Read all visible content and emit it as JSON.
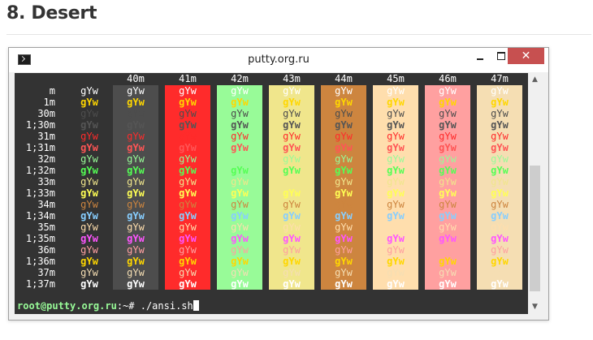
{
  "page": {
    "heading": "8. Desert"
  },
  "window": {
    "title": "putty.org.ru",
    "icon": "terminal-icon",
    "controls": {
      "minimize": "minimize-icon",
      "maximize": "maximize-icon",
      "close": "✕"
    }
  },
  "terminal": {
    "background": "#333333",
    "sample_text": "gYw",
    "backgrounds": [
      {
        "code": "",
        "color": null
      },
      {
        "code": "40m",
        "color": "#4d4d4d"
      },
      {
        "code": "41m",
        "color": "#ff2b2b"
      },
      {
        "code": "42m",
        "color": "#98fb98"
      },
      {
        "code": "43m",
        "color": "#f0e68c"
      },
      {
        "code": "44m",
        "color": "#cd853f"
      },
      {
        "code": "45m",
        "color": "#ffdead"
      },
      {
        "code": "46m",
        "color": "#ffa0a0"
      },
      {
        "code": "47m",
        "color": "#f5deb3"
      }
    ],
    "rows": [
      {
        "label": "m",
        "color": "#ffffff",
        "bold": false
      },
      {
        "label": "1m",
        "color": "#ffd700",
        "bold": true
      },
      {
        "label": "30m",
        "color": "#4d4d4d",
        "bold": false
      },
      {
        "label": "1;30m",
        "color": "#555555",
        "bold": true
      },
      {
        "label": "31m",
        "color": "#ff2b2b",
        "bold": false
      },
      {
        "label": "1;31m",
        "color": "#ff5555",
        "bold": true
      },
      {
        "label": "32m",
        "color": "#98fb98",
        "bold": false
      },
      {
        "label": "1;32m",
        "color": "#55ff55",
        "bold": true
      },
      {
        "label": "33m",
        "color": "#f0e68c",
        "bold": false
      },
      {
        "label": "1;33m",
        "color": "#ffff55",
        "bold": true
      },
      {
        "label": "34m",
        "color": "#cd853f",
        "bold": false
      },
      {
        "label": "1;34m",
        "color": "#87ceff",
        "bold": true
      },
      {
        "label": "35m",
        "color": "#ffdead",
        "bold": false
      },
      {
        "label": "1;35m",
        "color": "#ff55ff",
        "bold": true
      },
      {
        "label": "36m",
        "color": "#ffa0a0",
        "bold": false
      },
      {
        "label": "1;36m",
        "color": "#ffd700",
        "bold": true
      },
      {
        "label": "37m",
        "color": "#f5deb3",
        "bold": false
      },
      {
        "label": "1;37m",
        "color": "#ffffff",
        "bold": true
      }
    ],
    "prompt": {
      "user_host": "root@putty.org.ru",
      "path": ":~# ",
      "command": "./ansi.sh"
    }
  },
  "scrollbar": {
    "up": "▲",
    "down": "▼",
    "thumb_start": 0.37,
    "thumb_size": 0.59
  }
}
